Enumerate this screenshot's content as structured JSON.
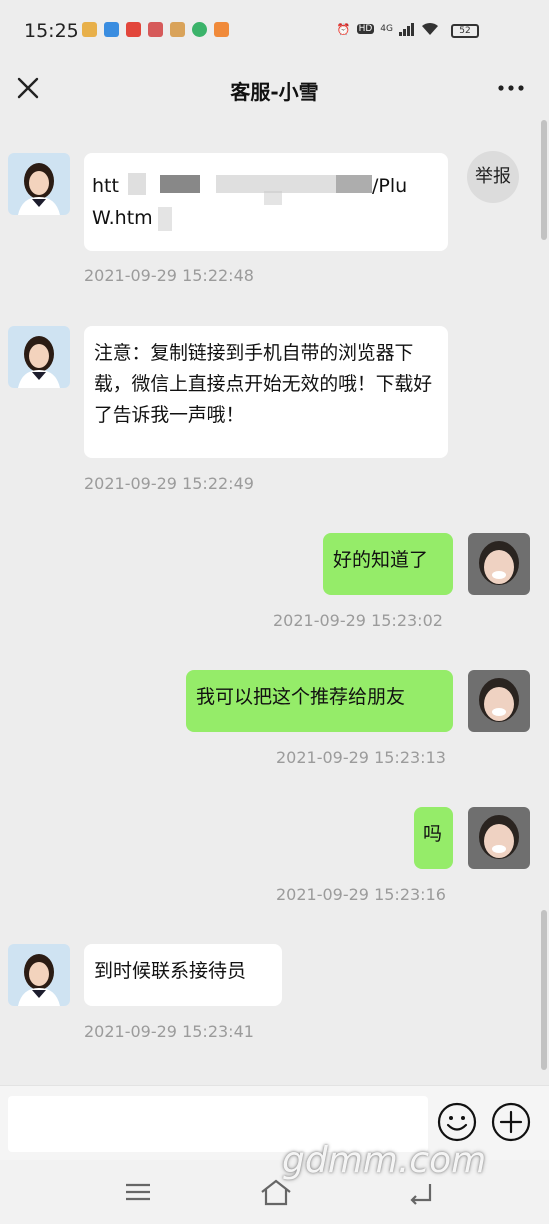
{
  "status_bar": {
    "time": "15:25",
    "network": "4G",
    "hd": "HD",
    "battery": "52"
  },
  "header": {
    "title": "客服-小雪"
  },
  "report_button": {
    "label": "举报"
  },
  "messages": [
    {
      "side": "left",
      "line1": "htt",
      "line1_end": "/Plu",
      "line2": "W.htm",
      "timestamp": "2021-09-29 15:22:48"
    },
    {
      "side": "left",
      "text": "注意：复制链接到手机自带的浏览器下载，微信上直接点开始无效的哦！下载好了告诉我一声哦！",
      "timestamp": "2021-09-29 15:22:49"
    },
    {
      "side": "right",
      "text": "好的知道了",
      "timestamp": "2021-09-29 15:23:02"
    },
    {
      "side": "right",
      "text": "我可以把这个推荐给朋友",
      "timestamp": "2021-09-29 15:23:13"
    },
    {
      "side": "right",
      "text": "吗",
      "timestamp": "2021-09-29 15:23:16"
    },
    {
      "side": "left",
      "text": "到时候联系接待员",
      "timestamp": "2021-09-29 15:23:41"
    }
  ],
  "input": {
    "placeholder": ""
  },
  "watermark": {
    "text": "gdmm.com"
  },
  "colors": {
    "background": "#ededed",
    "self_bubble": "#95ec69",
    "other_bubble": "#ffffff",
    "timestamp": "#9b9b9b"
  },
  "icons": [
    "close-icon",
    "more-icon",
    "emoji-icon",
    "plus-icon",
    "menu-icon",
    "home-icon",
    "back-icon"
  ]
}
